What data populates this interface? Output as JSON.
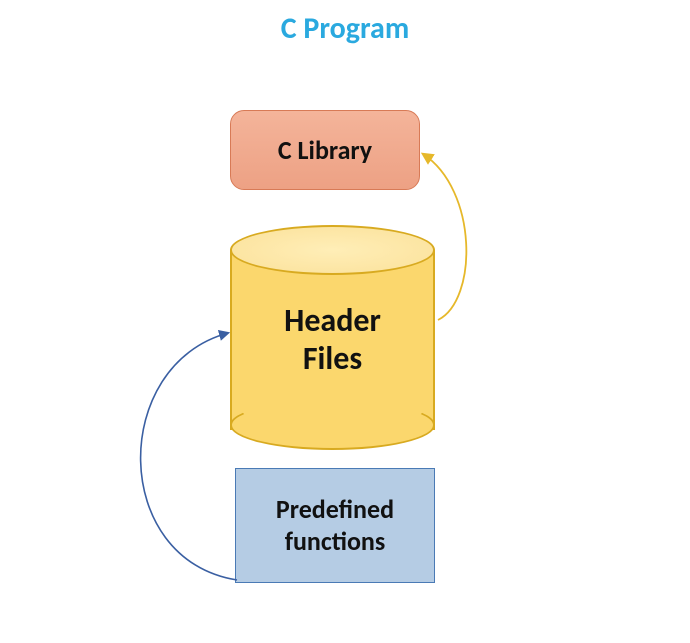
{
  "title": "C Program",
  "colors": {
    "title": "#2aa9df",
    "library_bg": "#f1a98c",
    "library_border": "#d87a56",
    "cylinder_bg": "#fbd76d",
    "cylinder_border": "#d8aa20",
    "functions_bg": "#b5cce4",
    "functions_border": "#4a7ab5",
    "arrow_blue": "#3a5fa2",
    "arrow_yellow": "#e6b82a"
  },
  "nodes": {
    "library": {
      "label": "C Library"
    },
    "header_files": {
      "label": "Header Files"
    },
    "predefined_functions": {
      "label": "Predefined functions"
    }
  },
  "arrows": [
    {
      "from": "predefined_functions",
      "to": "header_files",
      "color": "blue"
    },
    {
      "from": "header_files",
      "to": "library",
      "color": "yellow"
    }
  ]
}
